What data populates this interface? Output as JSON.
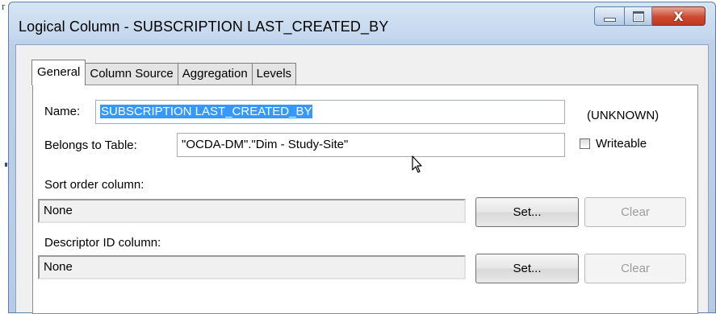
{
  "corner_glyph": "r",
  "window": {
    "title": "Logical Column - SUBSCRIPTION LAST_CREATED_BY",
    "controls": {
      "minimize": "minimize-icon",
      "maximize": "maximize-icon",
      "close": "close-icon",
      "close_glyph": "X"
    }
  },
  "tabs": [
    {
      "label": "General",
      "active": true
    },
    {
      "label": "Column Source",
      "active": false
    },
    {
      "label": "Aggregation",
      "active": false
    },
    {
      "label": "Levels",
      "active": false
    }
  ],
  "general": {
    "name_label": "Name:",
    "name_value": "SUBSCRIPTION LAST_CREATED_BY",
    "type_text": "(UNKNOWN)",
    "belongs_label": "Belongs to Table:",
    "belongs_value": "\"OCDA-DM\".\"Dim - Study-Site\"",
    "writeable_label": "Writeable",
    "writeable_checked": false,
    "sort_label": "Sort order column:",
    "sort_value": "None",
    "sort_set": "Set...",
    "sort_clear": "Clear",
    "descriptor_label": "Descriptor ID column:",
    "descriptor_value": "None",
    "descriptor_set": "Set...",
    "descriptor_clear": "Clear"
  },
  "colors": {
    "selection": "#3399ff",
    "close_button": "#c8432b",
    "titlebar": "#c9dbef"
  }
}
